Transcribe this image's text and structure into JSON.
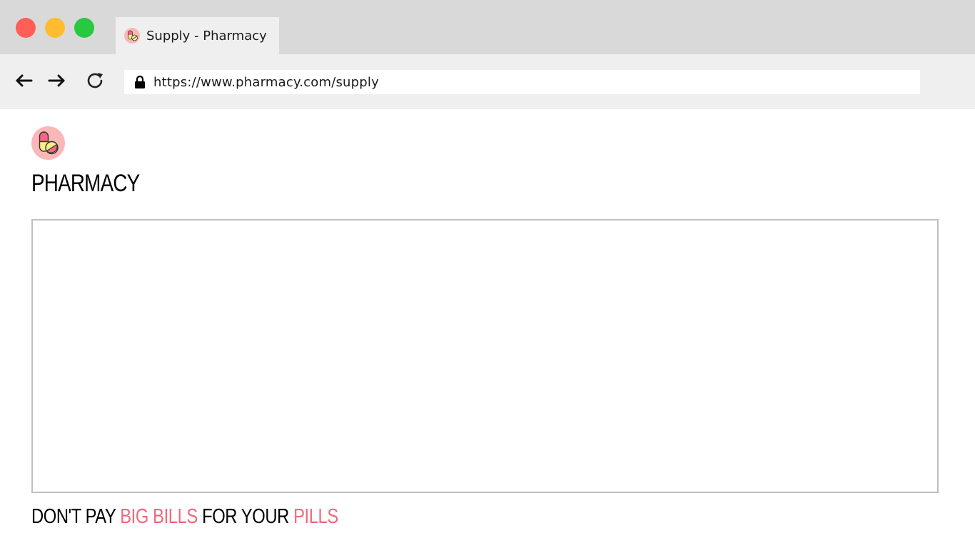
{
  "browser": {
    "window_controls": [
      "close",
      "minimize",
      "maximize"
    ],
    "tab": {
      "title": "Supply - Pharmacy",
      "favicon": "pill-icon"
    },
    "nav": {
      "back_icon": "arrow-left-icon",
      "forward_icon": "arrow-right-icon",
      "reload_icon": "reload-icon"
    },
    "address_bar": {
      "url": "https://www.pharmacy.com/supply",
      "lock_icon": "lock-icon"
    }
  },
  "page": {
    "logo_icon": "pill-icon",
    "brand": "PHARMACY",
    "tagline": {
      "part1": "DON'T PAY ",
      "accent1": "BIG BILLS",
      "part2": " FOR YOUR ",
      "accent2": "PILLS"
    }
  },
  "colors": {
    "titlebar": "#d9d9d9",
    "toolbar": "#efefef",
    "accent": "#f0697c",
    "logo_bg": "#f9b8b8",
    "close": "#ff5f57",
    "minimize": "#febc2e",
    "maximize": "#28c840"
  }
}
